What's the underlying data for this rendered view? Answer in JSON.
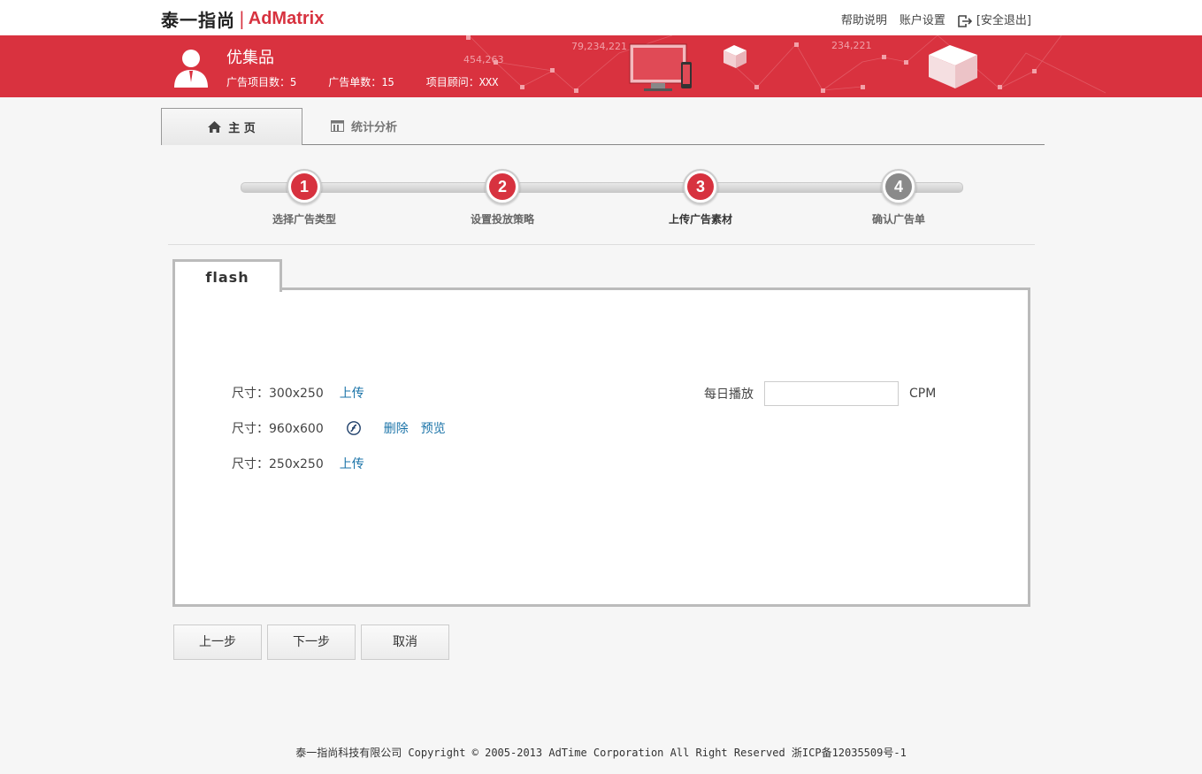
{
  "header": {
    "logo_cn": "泰一指尚",
    "logo_sep": "|",
    "logo_en": "AdMatrix",
    "links": {
      "help": "帮助说明",
      "account": "账户设置",
      "logout": "[安全退出]"
    }
  },
  "banner": {
    "name": "优集品",
    "stats": {
      "ad_projects": "广告项目数：5",
      "ad_orders": "广告单数：15",
      "consultant": "项目顾问：XXX"
    },
    "deco_numbers": [
      "79,234,221",
      "454,263",
      "234,221"
    ],
    "colors": {
      "banner": "#d9323f"
    }
  },
  "tabs": {
    "home": "主 页",
    "stats": "统计分析"
  },
  "steps": [
    {
      "num": "1",
      "label": "选择广告类型",
      "state": "done"
    },
    {
      "num": "2",
      "label": "设置投放策略",
      "state": "done"
    },
    {
      "num": "3",
      "label": "上传广告素材",
      "state": "current"
    },
    {
      "num": "4",
      "label": "确认广告单",
      "state": "pending"
    }
  ],
  "content": {
    "tab_label": "flash",
    "sizes": [
      {
        "label": "尺寸：300x250",
        "actions": [
          "上传"
        ]
      },
      {
        "label": "尺寸：960x600",
        "icon": "flash-file-icon",
        "actions": [
          "删除",
          "预览"
        ]
      },
      {
        "label": "尺寸：250x250",
        "actions": [
          "上传"
        ]
      }
    ],
    "daily": {
      "label": "每日播放",
      "value": "",
      "unit": "CPM"
    }
  },
  "buttons": {
    "prev": "上一步",
    "next": "下一步",
    "cancel": "取消"
  },
  "footer": "泰一指尚科技有限公司 Copyright © 2005-2013 AdTime Corporation All Right Reserved 浙ICP备12035509号-1"
}
